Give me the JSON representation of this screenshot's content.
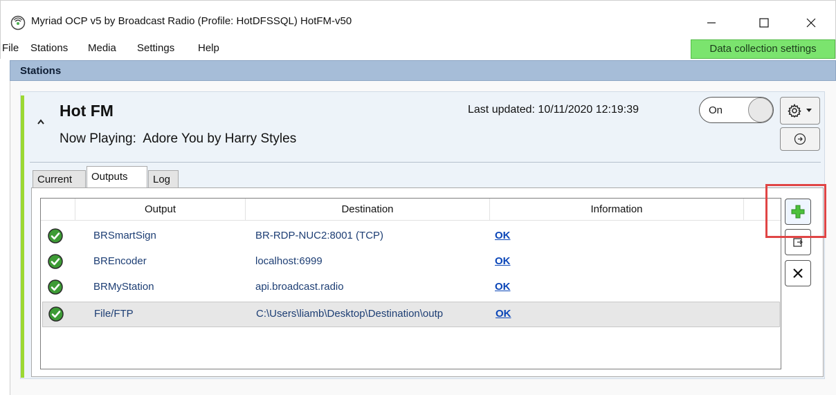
{
  "window": {
    "title": "Myriad OCP v5 by Broadcast Radio (Profile: HotDFSSQL) HotFM-v50",
    "icon": "radio-signal-icon"
  },
  "menu": {
    "items": [
      "File",
      "Stations",
      "Media",
      "Settings",
      "Help"
    ],
    "data_collection_label": "Data collection settings",
    "data_collection_color": "#7be46e"
  },
  "stations_header": "Stations",
  "station": {
    "name": "Hot FM",
    "now_playing_label": "Now Playing:",
    "now_playing_value": "Adore You by Harry Styles",
    "last_updated_label": "Last updated:",
    "last_updated_value": "10/11/2020 12:19:39",
    "toggle_label": "On",
    "accent_color": "#9bd833"
  },
  "tabs": [
    "Current",
    "Outputs",
    "Log"
  ],
  "active_tab": "Outputs",
  "outputs_table": {
    "columns": [
      "Output",
      "Destination",
      "Information"
    ],
    "rows": [
      {
        "status": "ok",
        "output": "BRSmartSign",
        "destination": "BR-RDP-NUC2:8001 (TCP)",
        "information": "OK"
      },
      {
        "status": "ok",
        "output": "BREncoder",
        "destination": "localhost:6999",
        "information": "OK"
      },
      {
        "status": "ok",
        "output": "BRMyStation",
        "destination": "api.broadcast.radio",
        "information": "OK"
      },
      {
        "status": "ok",
        "output": "File/FTP",
        "destination": "C:\\Users\\liamb\\Desktop\\Destination\\outp",
        "information": "OK"
      }
    ],
    "selected_row": 3
  },
  "side_buttons": {
    "add": "plus-icon",
    "export": "export-icon",
    "remove": "close-icon"
  },
  "highlight_color": "#e04545"
}
